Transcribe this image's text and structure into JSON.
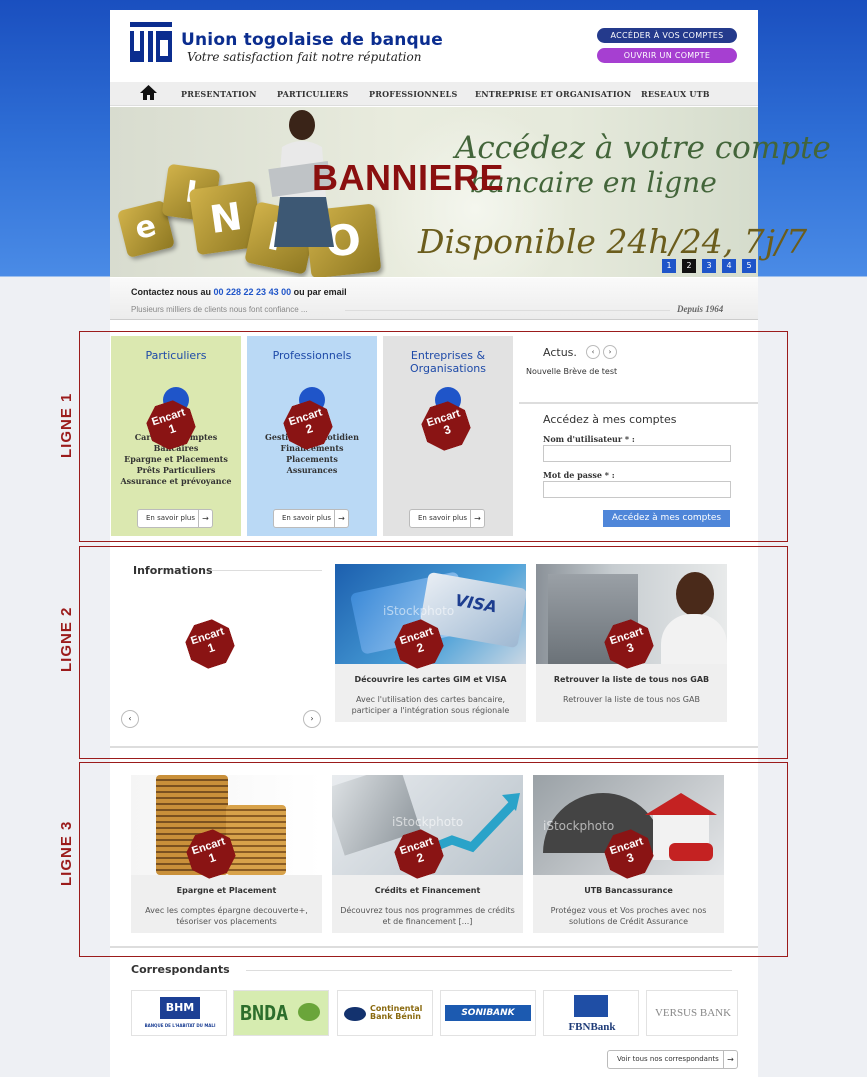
{
  "header": {
    "brand": "Union togolaise de banque",
    "tagline": "Votre satisfaction fait notre réputation",
    "btn_access": "ACCÉDER À VOS COMPTES",
    "btn_open": "OUVRIR UN COMPTE"
  },
  "nav": {
    "items": [
      "PRESENTATION",
      "PARTICULIERS",
      "PROFESSIONNELS",
      "ENTREPRISE ET ORGANISATION",
      "RESEAUX UTB"
    ]
  },
  "banner": {
    "line1": "Accédez à votre compte",
    "line2": "bancaire en ligne",
    "line3": "Disponible 24h/24, 7j/7",
    "overlay": "BANNIERE",
    "blocks": [
      "e",
      "I",
      "N",
      "F",
      "O"
    ],
    "pages": [
      "1",
      "2",
      "3",
      "4",
      "5"
    ],
    "active_page": "2"
  },
  "contact": {
    "prefix": "Contactez nous au ",
    "phone": "00 228 22 23 43 00",
    "suffix": " ou par email",
    "trust": "Plusieurs milliers de clients nous font confiance ...",
    "since": "Depuis 1964"
  },
  "rows": {
    "l1": "LIGNE 1",
    "l2": "LIGNE 2",
    "l3": "LIGNE 3"
  },
  "encart": {
    "word": "Encart",
    "n1": "1",
    "n2": "2",
    "n3": "3"
  },
  "line1": {
    "particuliers": {
      "title": "Particuliers",
      "lines": [
        "Cartes et Comptes",
        "Bancaires",
        "Epargne et Placements",
        "Prêts Particuliers",
        "Assurance et prévoyance"
      ],
      "more": "En savoir plus",
      "color": "#dbe8b0"
    },
    "professionnels": {
      "title": "Professionnels",
      "lines": [
        "Gestion au quotidien",
        "Financements",
        "Placements",
        "Assurances"
      ],
      "more": "En savoir plus",
      "color": "#bad9f5"
    },
    "entreprises": {
      "title": "Entreprises & Organisations",
      "more": "En savoir plus",
      "color": "#e2e2e2"
    },
    "actus": {
      "title": "Actus.",
      "item": "Nouvelle Brève de test"
    },
    "login": {
      "title": "Accédez à mes comptes",
      "user_label": "Nom d'utilisateur * :",
      "pass_label": "Mot de passe * :",
      "button": "Accédez à mes comptes"
    }
  },
  "line2": {
    "title": "Informations",
    "card2": {
      "title": "Découvrire les cartes GIM et VISA",
      "text1": "Avec l'utilisation des cartes bancaire,",
      "text2": "participer a l'intégration sous régionale"
    },
    "card3": {
      "title": "Retrouver la liste de tous nos GAB",
      "text1": "Retrouver la liste de tous nos GAB"
    }
  },
  "line3": {
    "card1": {
      "title": "Epargne et Placement",
      "text1": "Avec les comptes épargne decouverte+,",
      "text2": "tésoriser vos placements"
    },
    "card2": {
      "title": "Crédits et Financement",
      "text1": "Découvrez tous nos programmes de crédits",
      "text2": "et de financement [...]"
    },
    "card3": {
      "title": "UTB Bancassurance",
      "text1": "Protégez vous et Vos proches avec nos",
      "text2": "solutions de Crédit Assurance"
    }
  },
  "correspondants": {
    "title": "Correspondants",
    "bhm": "BHM",
    "bhm_sub": "BANQUE DE L'HABITAT DU MALI",
    "bnda": "BNDA",
    "continental": "Continental Bank Bénin",
    "sonibank": "SONIBANK",
    "fbn": "FBNBank",
    "versus": "VERSUS BANK",
    "all": "Voir tous nos correspondants"
  },
  "watermark": "iStockphoto",
  "colors": {
    "brand_blue": "#0b2d8f",
    "accent_red": "#8a1414",
    "link_blue": "#1f55c9"
  }
}
